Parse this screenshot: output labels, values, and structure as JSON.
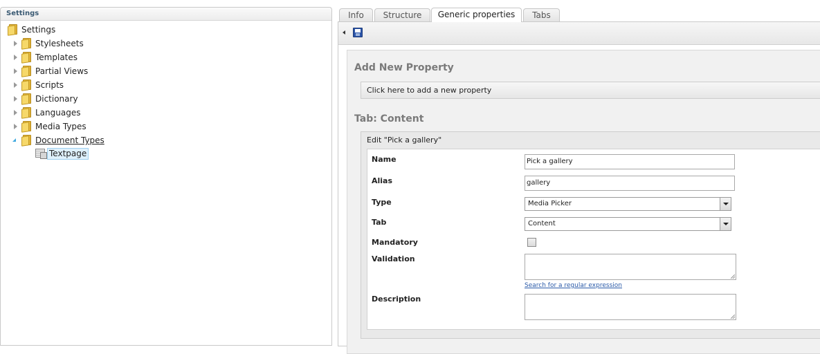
{
  "tree": {
    "header": "Settings",
    "root": {
      "label": "Settings",
      "icon": "folder-icon"
    },
    "items": [
      {
        "label": "Stylesheets",
        "expanded": false
      },
      {
        "label": "Templates",
        "expanded": false
      },
      {
        "label": "Partial Views",
        "expanded": false
      },
      {
        "label": "Scripts",
        "expanded": false
      },
      {
        "label": "Dictionary",
        "expanded": false
      },
      {
        "label": "Languages",
        "expanded": false
      },
      {
        "label": "Media Types",
        "expanded": false
      },
      {
        "label": "Document Types",
        "expanded": true
      }
    ],
    "child": {
      "label": "Textpage",
      "selected": true
    }
  },
  "tabs": [
    {
      "label": "Info",
      "active": false
    },
    {
      "label": "Structure",
      "active": false
    },
    {
      "label": "Generic properties",
      "active": true
    },
    {
      "label": "Tabs",
      "active": false
    }
  ],
  "toolbar": {
    "save_icon": "save-icon"
  },
  "add_property": {
    "title": "Add New Property",
    "bar_label": "Click here to add a new property"
  },
  "tab_content": {
    "title": "Tab: Content",
    "edit_title": "Edit \"Pick a gallery\"",
    "fields": {
      "name": {
        "label": "Name",
        "value": "Pick a gallery"
      },
      "alias": {
        "label": "Alias",
        "value": "gallery"
      },
      "type": {
        "label": "Type",
        "value": "Media Picker"
      },
      "tab": {
        "label": "Tab",
        "value": "Content"
      },
      "mandatory": {
        "label": "Mandatory",
        "checked": false
      },
      "validation": {
        "label": "Validation",
        "value": "",
        "link": "Search for a regular expression"
      },
      "description": {
        "label": "Description",
        "value": ""
      }
    }
  }
}
